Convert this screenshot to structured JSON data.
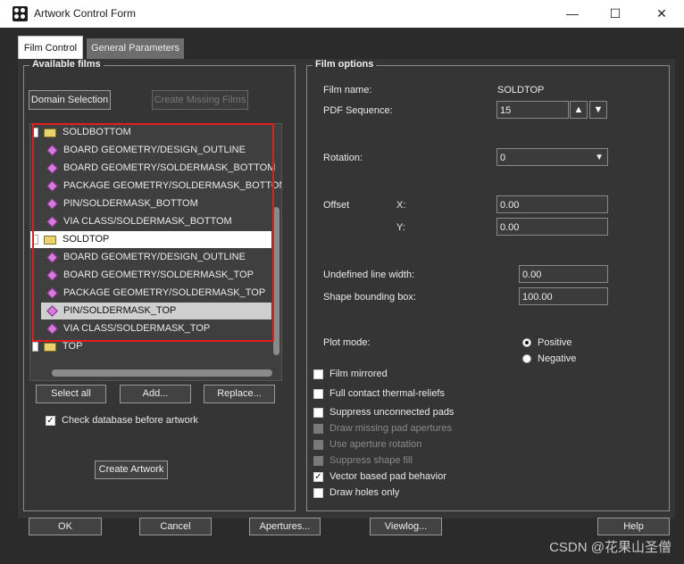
{
  "window": {
    "title": "Artwork Control Form",
    "minimize": "—",
    "maximize": "☐",
    "close": "✕"
  },
  "tabs": [
    {
      "label": "Film Control"
    },
    {
      "label": "General Parameters"
    }
  ],
  "available_films": {
    "title": "Available films",
    "domain_selection": "Domain Selection",
    "create_missing": "Create Missing Films",
    "tree": [
      {
        "label": "SOLDBOTTOM",
        "type": "film"
      },
      {
        "label": "BOARD GEOMETRY/DESIGN_OUTLINE",
        "type": "layer"
      },
      {
        "label": "BOARD GEOMETRY/SOLDERMASK_BOTTOM",
        "type": "layer"
      },
      {
        "label": "PACKAGE GEOMETRY/SOLDERMASK_BOTTOM",
        "type": "layer"
      },
      {
        "label": "PIN/SOLDERMASK_BOTTOM",
        "type": "layer"
      },
      {
        "label": "VIA CLASS/SOLDERMASK_BOTTOM",
        "type": "layer"
      },
      {
        "label": "SOLDTOP",
        "type": "film",
        "selected": true
      },
      {
        "label": "BOARD GEOMETRY/DESIGN_OUTLINE",
        "type": "layer"
      },
      {
        "label": "BOARD GEOMETRY/SOLDERMASK_TOP",
        "type": "layer"
      },
      {
        "label": "PACKAGE GEOMETRY/SOLDERMASK_TOP",
        "type": "layer"
      },
      {
        "label": "PIN/SOLDERMASK_TOP",
        "type": "layer",
        "highlighted": true
      },
      {
        "label": "VIA CLASS/SOLDERMASK_TOP",
        "type": "layer"
      },
      {
        "label": "TOP",
        "type": "film"
      }
    ],
    "select_all": "Select all",
    "add": "Add...",
    "replace": "Replace...",
    "check_db": "Check database before artwork",
    "check_db_checked": true,
    "create_artwork": "Create Artwork"
  },
  "film_options": {
    "title": "Film options",
    "film_name_label": "Film name:",
    "film_name": "SOLDTOP",
    "pdf_seq_label": "PDF Sequence:",
    "pdf_seq": "15",
    "rotation_label": "Rotation:",
    "rotation": "0",
    "offset_label": "Offset",
    "x_label": "X:",
    "x": "0.00",
    "y_label": "Y:",
    "y": "0.00",
    "undef_width_label": "Undefined line width:",
    "undef_width": "0.00",
    "shape_bbox_label": "Shape bounding box:",
    "shape_bbox": "100.00",
    "plot_mode_label": "Plot mode:",
    "positive": "Positive",
    "negative": "Negative",
    "plot_mode": "Positive",
    "checks": [
      {
        "label": "Film mirrored",
        "checked": false,
        "enabled": true
      },
      {
        "label": "Full contact thermal-reliefs",
        "checked": false,
        "enabled": true
      },
      {
        "label": "Suppress unconnected pads",
        "checked": false,
        "enabled": true
      },
      {
        "label": "Draw missing pad apertures",
        "checked": false,
        "enabled": false
      },
      {
        "label": "Use aperture rotation",
        "checked": false,
        "enabled": false
      },
      {
        "label": "Suppress shape fill",
        "checked": false,
        "enabled": false
      },
      {
        "label": "Vector based pad behavior",
        "checked": true,
        "enabled": true
      },
      {
        "label": "Draw holes only",
        "checked": false,
        "enabled": true
      }
    ]
  },
  "footer": {
    "ok": "OK",
    "cancel": "Cancel",
    "apertures": "Apertures...",
    "viewlog": "Viewlog...",
    "help": "Help"
  },
  "watermark": "CSDN @花果山圣僧",
  "colors": {
    "selection_outline": "#e11d1d",
    "layer_icon": "#d57bd9",
    "folder_icon": "#e8d36c"
  }
}
